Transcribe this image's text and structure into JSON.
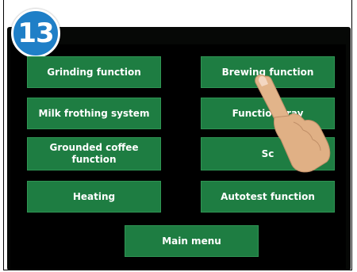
{
  "step_badge": "13",
  "buttons": {
    "grinding": "Grinding function",
    "brewing": "Brewing function",
    "milk": "Milk frothing system",
    "tray": "Function tray",
    "grounded_line1": "Grounded coffee",
    "grounded_line2": "function",
    "sc": "Sc",
    "heating": "Heating",
    "autotest": "Autotest function",
    "main_menu": "Main menu"
  },
  "colors": {
    "button_green": "#1e7d42",
    "badge_blue": "#1f7fc7",
    "screen_background": "#000000"
  },
  "icons": {
    "hand": "pointing-hand-icon"
  }
}
